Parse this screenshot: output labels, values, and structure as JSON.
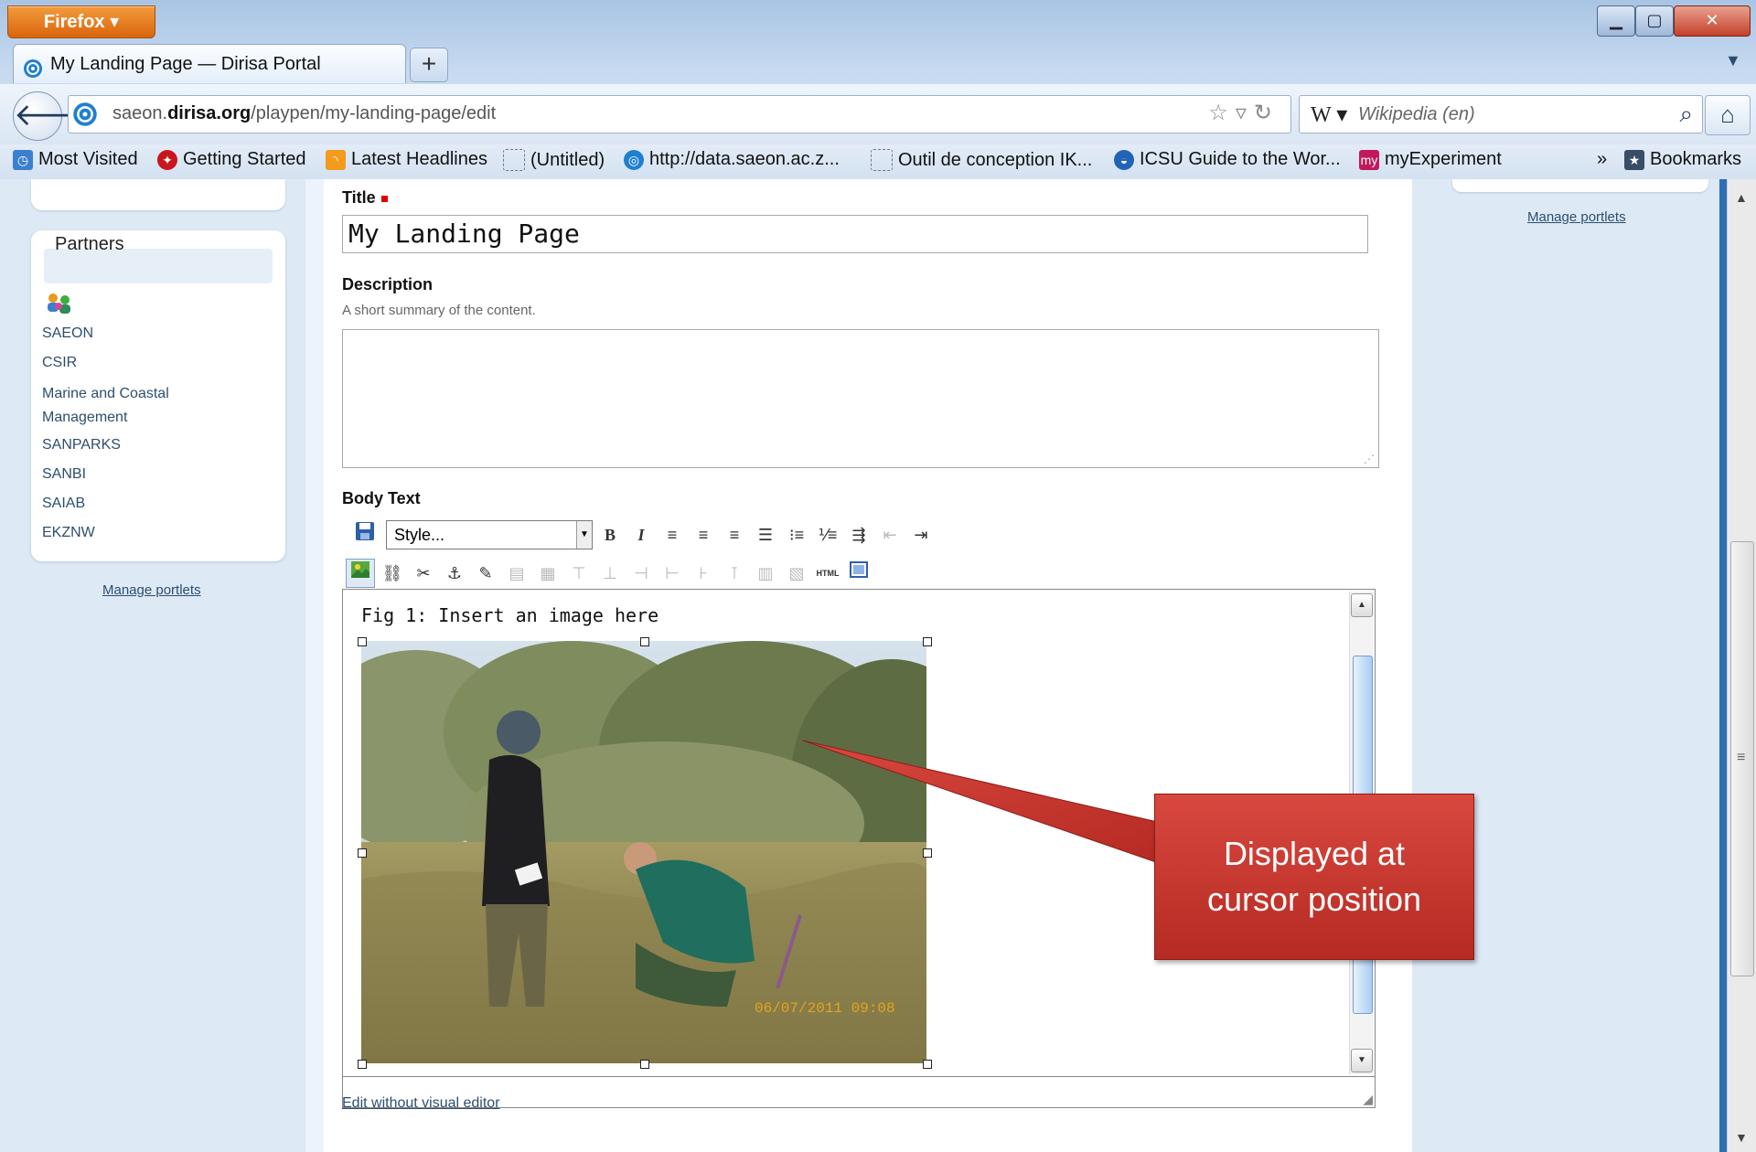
{
  "browser": {
    "menu_button": "Firefox ▾",
    "tab_title": "My Landing Page — Dirisa Portal",
    "new_tab": "+",
    "url_host_prefix": "saeon.",
    "url_host_domain": "dirisa.org",
    "url_path": "/playpen/my-landing-page/edit",
    "search_engine": "W ▾",
    "search_placeholder": "Wikipedia (en)",
    "bookmarks": [
      {
        "label": "Most Visited"
      },
      {
        "label": "Getting Started"
      },
      {
        "label": "Latest Headlines"
      },
      {
        "label": "(Untitled)"
      },
      {
        "label": "http://data.saeon.ac.z..."
      },
      {
        "label": "Outil de conception IK..."
      },
      {
        "label": "ICSU Guide to the Wor..."
      },
      {
        "label": "myExperiment"
      }
    ],
    "bookmarks_overflow": "»",
    "bookmarks_menu": "Bookmarks"
  },
  "left_sidebar": {
    "portlet_title": "Partners",
    "partners": [
      "SAEON",
      "CSIR",
      "Marine and Coastal Management",
      "SANPARKS",
      "SANBI",
      "SAIAB",
      "EKZNW"
    ],
    "manage_portlets": "Manage portlets"
  },
  "right_sidebar": {
    "manage_portlets": "Manage portlets"
  },
  "form": {
    "title_label": "Title",
    "title_value": "My Landing Page",
    "description_label": "Description",
    "description_help": "A short summary of the content.",
    "description_value": "",
    "body_label": "Body Text",
    "style_select": "Style...",
    "editor_text": "Fig 1: Insert an image here",
    "photo_timestamp": "06/07/2011 09:08",
    "edit_without_visual": "Edit without visual editor"
  },
  "callout": {
    "line1": "Displayed at",
    "line2": "cursor position"
  }
}
